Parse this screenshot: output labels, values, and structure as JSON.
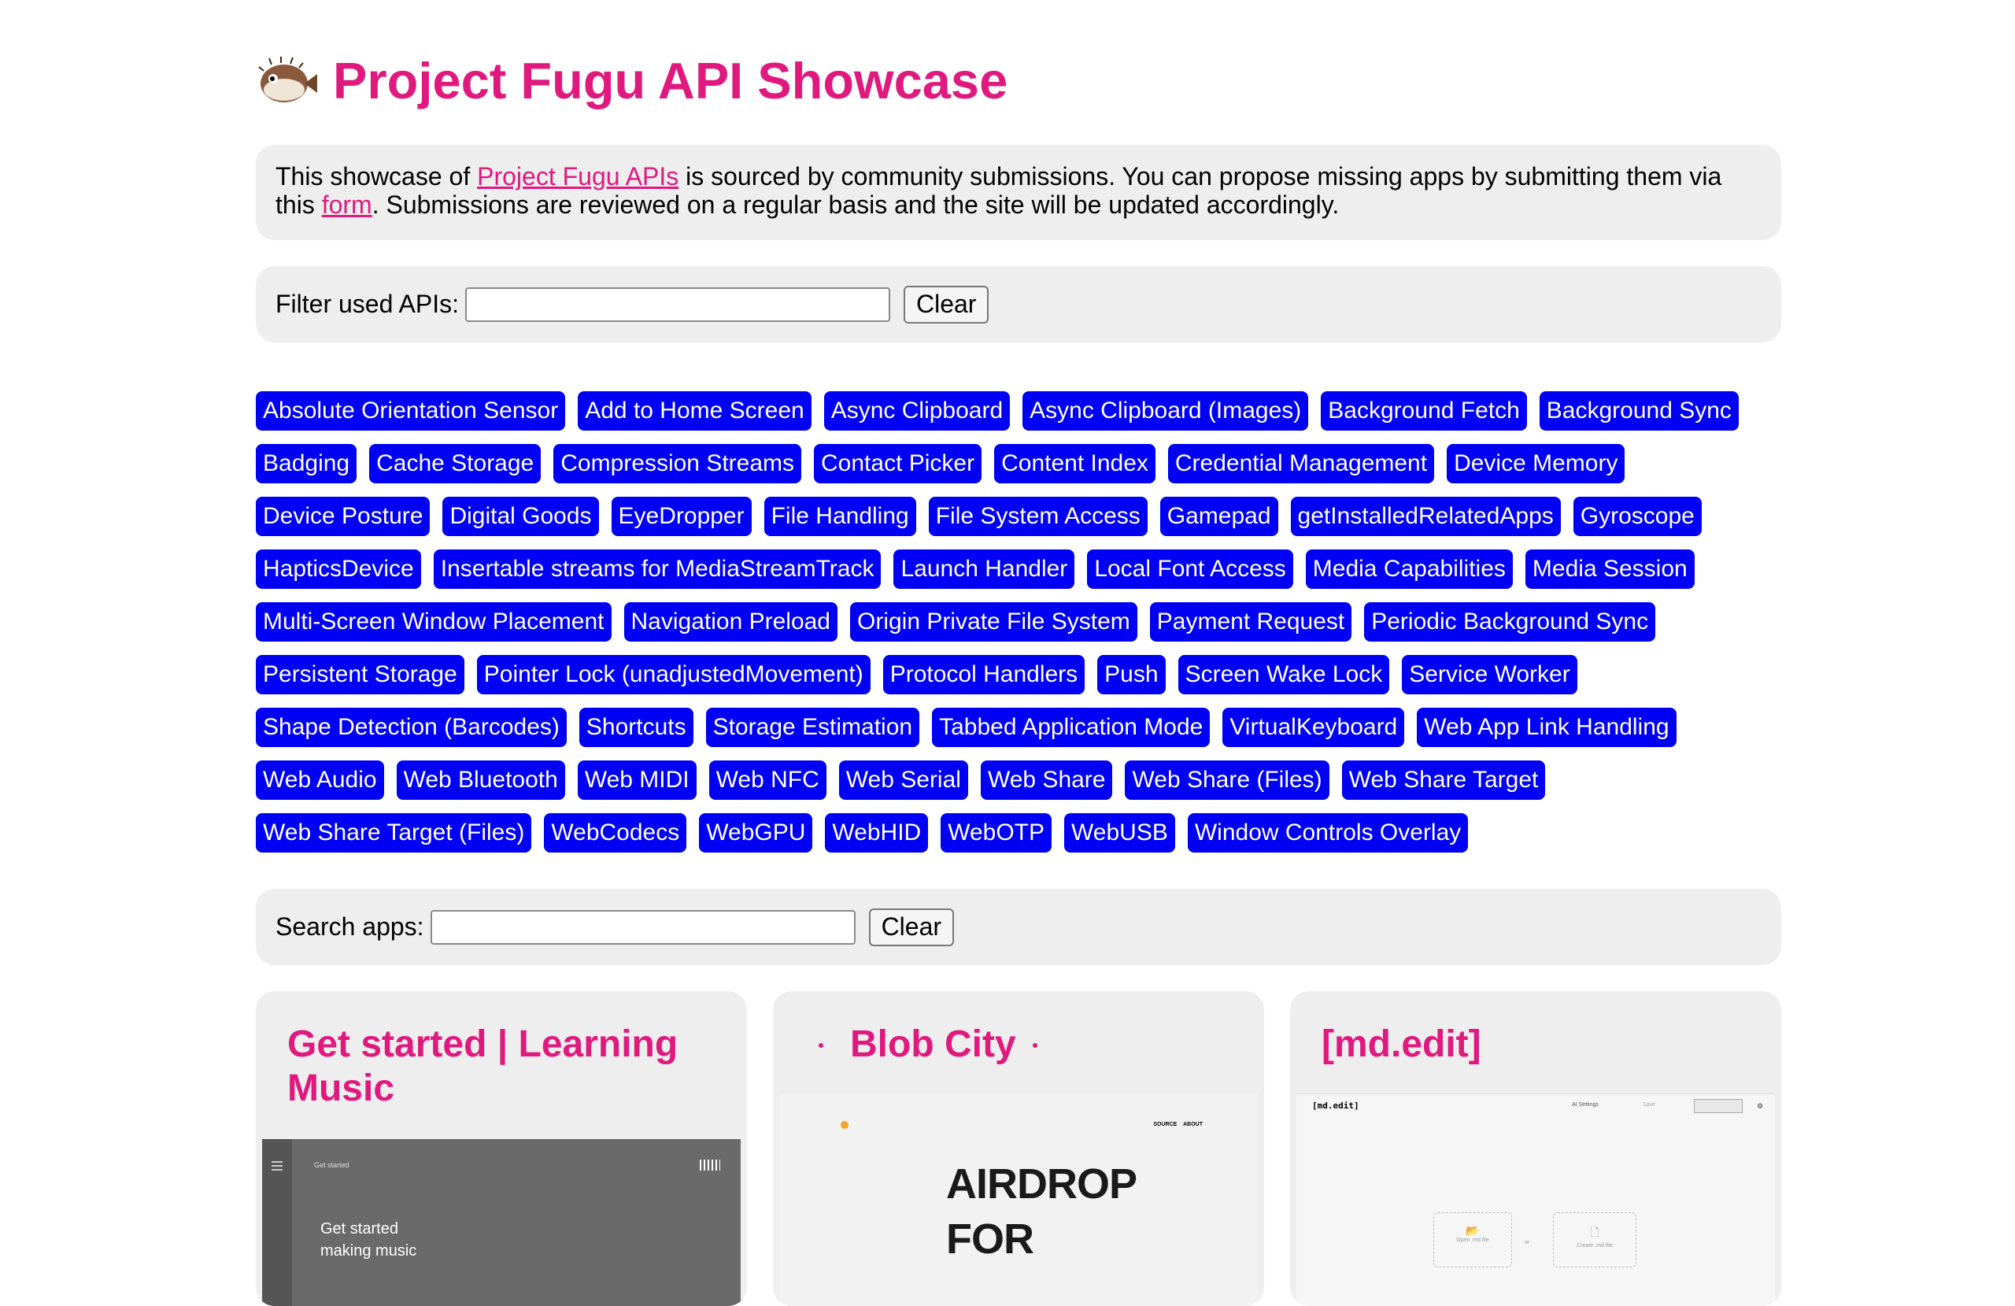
{
  "header": {
    "title": "Project Fugu API Showcase",
    "logo_icon": "pufferfish-icon"
  },
  "intro": {
    "text_before": "This showcase of ",
    "link1": "Project Fugu APIs",
    "text_middle": " is sourced by community submissions. You can propose missing apps by submitting them via this ",
    "link2": "form",
    "text_after": ". Submissions are reviewed on a regular basis and the site will be updated accordingly."
  },
  "filter": {
    "label": "Filter used APIs:",
    "value": "",
    "clear_label": "Clear"
  },
  "apis": [
    "Absolute Orientation Sensor",
    "Add to Home Screen",
    "Async Clipboard",
    "Async Clipboard (Images)",
    "Background Fetch",
    "Background Sync",
    "Badging",
    "Cache Storage",
    "Compression Streams",
    "Contact Picker",
    "Content Index",
    "Credential Management",
    "Device Memory",
    "Device Posture",
    "Digital Goods",
    "EyeDropper",
    "File Handling",
    "File System Access",
    "Gamepad",
    "getInstalledRelatedApps",
    "Gyroscope",
    "HapticsDevice",
    "Insertable streams for MediaStreamTrack",
    "Launch Handler",
    "Local Font Access",
    "Media Capabilities",
    "Media Session",
    "Multi-Screen Window Placement",
    "Navigation Preload",
    "Origin Private File System",
    "Payment Request",
    "Periodic Background Sync",
    "Persistent Storage",
    "Pointer Lock (unadjustedMovement)",
    "Protocol Handlers",
    "Push",
    "Screen Wake Lock",
    "Service Worker",
    "Shape Detection (Barcodes)",
    "Shortcuts",
    "Storage Estimation",
    "Tabbed Application Mode",
    "VirtualKeyboard",
    "Web App Link Handling",
    "Web Audio",
    "Web Bluetooth",
    "Web MIDI",
    "Web NFC",
    "Web Serial",
    "Web Share",
    "Web Share (Files)",
    "Web Share Target",
    "Web Share Target (Files)",
    "WebCodecs",
    "WebGPU",
    "WebHID",
    "WebOTP",
    "WebUSB",
    "Window Controls Overlay"
  ],
  "search": {
    "label": "Search apps:",
    "value": "",
    "clear_label": "Clear"
  },
  "cards": [
    {
      "title": "Get started | Learning Music",
      "shot_heading": "Get started",
      "shot_line1": "Get started",
      "shot_line2": "making music"
    },
    {
      "title": "Blob City",
      "shot_nav1": "SOURCE",
      "shot_nav2": "ABOUT",
      "shot_big1": "AIRDROP",
      "shot_big2": "FOR"
    },
    {
      "title": "[md.edit]",
      "shot_brand": "[md.edit]",
      "shot_ai": "AI Settings",
      "shot_save": "Save",
      "shot_open": "Open .md file",
      "shot_or": "or",
      "shot_create": "Create .md file"
    }
  ],
  "colors": {
    "accent": "#e0197e",
    "tag_bg": "#0000f5",
    "panel_bg": "#eeeeee"
  }
}
